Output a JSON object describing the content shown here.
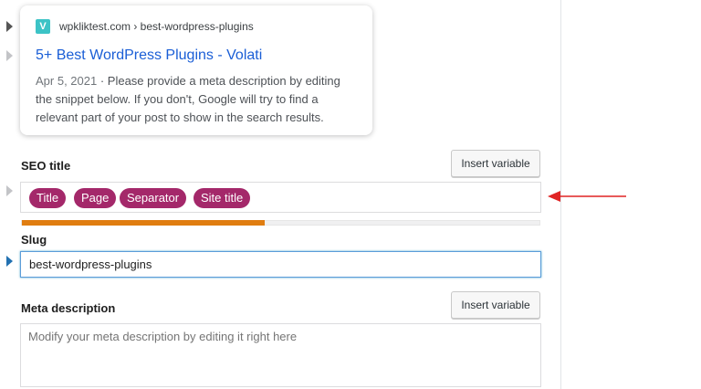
{
  "snippet_preview": {
    "favicon_letter": "V",
    "url": "wpkliktest.com › best-wordpress-plugins",
    "title": "5+ Best WordPress Plugins - Volati",
    "date": "Apr 5, 2021",
    "separator": " · ",
    "description": "Please provide a meta description by editing the snippet below. If you don't, Google will try to find a relevant part of your post to show in the search results."
  },
  "seo_title": {
    "label": "SEO title",
    "insert_variable_label": "Insert variable",
    "variables": [
      "Title",
      "Page",
      "Separator",
      "Site title"
    ],
    "length_progress": 0.47,
    "progress_color": "#e07d10"
  },
  "slug": {
    "label": "Slug",
    "value": "best-wordpress-plugins"
  },
  "meta_description": {
    "label": "Meta description",
    "insert_variable_label": "Insert variable",
    "placeholder": "Modify your meta description by editing it right here"
  },
  "colors": {
    "pill": "#a4286a",
    "annotation_arrow": "#e02424",
    "link": "#1a5ed6"
  }
}
